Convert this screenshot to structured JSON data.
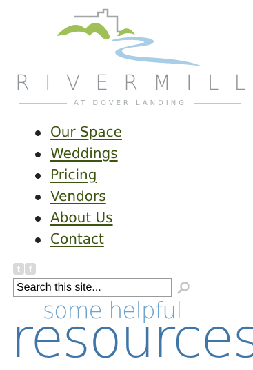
{
  "logo": {
    "brand": "RIVERMILL",
    "tagline": "AT DOVER LANDING",
    "colors": {
      "hills": "#9fbf57",
      "river": "#a8cde6",
      "building": "#a3a6a8"
    }
  },
  "nav": {
    "items": [
      {
        "label": "Our Space"
      },
      {
        "label": "Weddings"
      },
      {
        "label": "Pricing"
      },
      {
        "label": "Vendors"
      },
      {
        "label": "About Us"
      },
      {
        "label": "Contact"
      }
    ],
    "link_color": "#3c5410"
  },
  "social": {
    "twitter_icon": "t",
    "facebook_icon": "f"
  },
  "search": {
    "placeholder": "Search this site...",
    "value": "Search this site..."
  },
  "promo": {
    "line1": "some helpful",
    "line2": "resources"
  }
}
